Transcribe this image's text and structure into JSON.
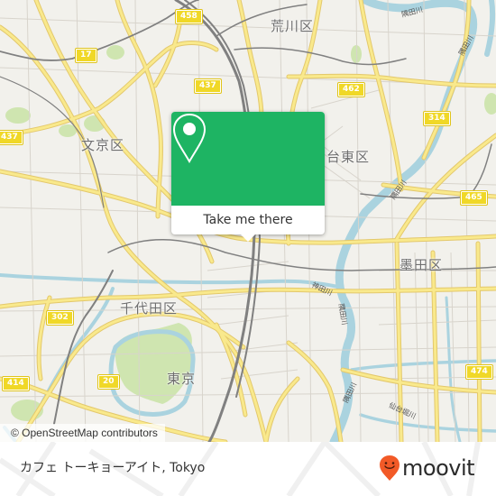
{
  "map": {
    "attribution": "© OpenStreetMap contributors",
    "districts": [
      {
        "id": "arakawa",
        "label": "荒川区"
      },
      {
        "id": "bunkyo",
        "label": "文京区"
      },
      {
        "id": "taito",
        "label": "台東区"
      },
      {
        "id": "sumida",
        "label": "墨田区"
      },
      {
        "id": "chiyoda",
        "label": "千代田区"
      },
      {
        "id": "tokyo",
        "label": "東京"
      }
    ],
    "route_shields": [
      "458",
      "17",
      "437",
      "437",
      "462",
      "314",
      "465",
      "302",
      "414",
      "20",
      "474"
    ],
    "river_labels": [
      "隅田川",
      "隅田川",
      "隅田川",
      "神田川",
      "隅田川",
      "隅田川",
      "仙台堀川"
    ],
    "colors": {
      "land": "#f2f1ec",
      "road_major": "#f6e27a",
      "water": "#aad3df",
      "park": "#cfe5b0",
      "rail": "#808080",
      "shield": "#f0d827"
    }
  },
  "popup": {
    "icon": "map-pin-icon",
    "button_label": "Take me there",
    "accent": "#1eb463"
  },
  "footer": {
    "place_name": "カフェ トーキョーアイト, Tokyo",
    "brand": "moovit",
    "brand_icon": "moovit-smiley-pin-icon",
    "brand_color": "#f25a27"
  }
}
